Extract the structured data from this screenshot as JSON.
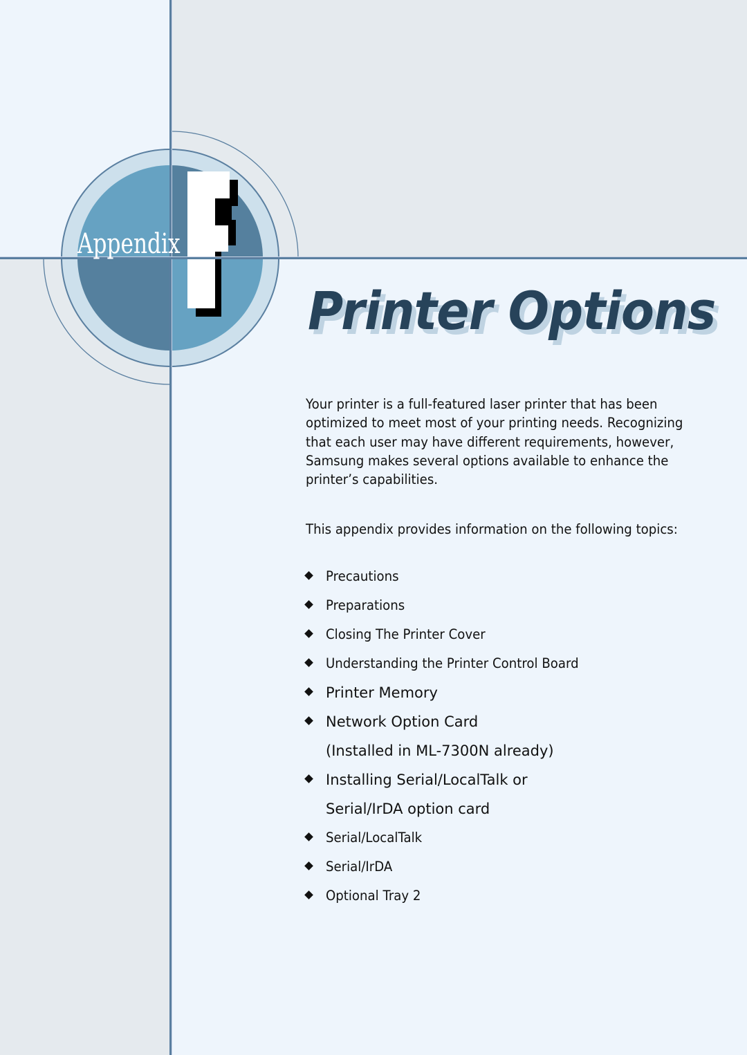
{
  "page": {
    "appendix_label": "Appendix",
    "appendix_letter": "F",
    "title": "Printer Options",
    "intro_paragraph": "Your printer is a full-featured laser printer that has been optimized to meet most of your printing needs. Recognizing that each user may have different requirements, however, Samsung makes several options available to enhance the printer’s capabilities.",
    "topics_intro": "This appendix provides information on the following topics:",
    "topics": [
      {
        "label": "Precautions",
        "bullet": true
      },
      {
        "label": "Preparations",
        "bullet": true
      },
      {
        "label": "Closing The Printer Cover",
        "bullet": true
      },
      {
        "label": "Understanding the Printer Control Board",
        "bullet": true
      },
      {
        "label": "Printer Memory",
        "bullet": true
      },
      {
        "label": "Network Option Card",
        "bullet": true
      },
      {
        "label": "(Installed in ML-7300N already)",
        "bullet": false
      },
      {
        "label": "Installing Serial/LocalTalk or",
        "bullet": true
      },
      {
        "label": "Serial/IrDA option card",
        "bullet": false
      },
      {
        "label": "Serial/LocalTalk",
        "bullet": true
      },
      {
        "label": "Serial/IrDA",
        "bullet": true
      },
      {
        "label": "Optional Tray 2",
        "bullet": true
      }
    ],
    "bullet_icon": "diamond-bullet",
    "colors": {
      "title": "#27435a",
      "title_shadow": "#bfd3e2",
      "circle_dark": "#55809e",
      "circle_light": "#66a2c2",
      "ring": "#cde0ec",
      "rule": "#5a7fa0"
    }
  }
}
